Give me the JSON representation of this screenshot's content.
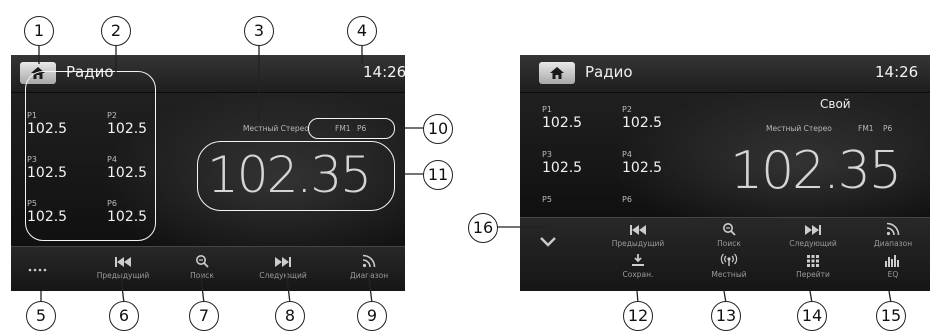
{
  "screen1": {
    "title": "Радио",
    "clock": "14:26",
    "presets": [
      {
        "label": "P1",
        "freq": "102.5"
      },
      {
        "label": "P2",
        "freq": "102.5"
      },
      {
        "label": "P3",
        "freq": "102.5"
      },
      {
        "label": "P4",
        "freq": "102.5"
      },
      {
        "label": "P5",
        "freq": "102.5"
      },
      {
        "label": "P6",
        "freq": "102.5"
      }
    ],
    "status_text": "Местный Стерео",
    "band": "FM1",
    "preset_indicator": "P6",
    "frequency": "102.35",
    "buttons": [
      {
        "label": "",
        "icon": "more-dots-icon"
      },
      {
        "label": "Предыдущий",
        "icon": "previous-icon"
      },
      {
        "label": "Поиск",
        "icon": "search-icon"
      },
      {
        "label": "Следующий",
        "icon": "next-icon"
      },
      {
        "label": "Диапазон",
        "icon": "band-icon"
      }
    ]
  },
  "screen2": {
    "title": "Радио",
    "clock": "14:26",
    "custom_label": "Свой",
    "presets": [
      {
        "label": "P1",
        "freq": "102.5"
      },
      {
        "label": "P2",
        "freq": "102.5"
      },
      {
        "label": "P3",
        "freq": "102.5"
      },
      {
        "label": "P4",
        "freq": "102.5"
      },
      {
        "label": "P5",
        "freq": ""
      },
      {
        "label": "P6",
        "freq": ""
      }
    ],
    "status_text": "Местный Стерео",
    "band": "FM1",
    "preset_indicator": "P6",
    "frequency": "102.35",
    "buttons_row1": [
      {
        "label": "Предыдущий",
        "icon": "previous-icon"
      },
      {
        "label": "Поиск",
        "icon": "search-icon"
      },
      {
        "label": "Следующий",
        "icon": "next-icon"
      },
      {
        "label": "Диапазон",
        "icon": "band-icon"
      }
    ],
    "buttons_row2": [
      {
        "label": "Сохран.",
        "icon": "save-icon"
      },
      {
        "label": "Местный",
        "icon": "local-icon"
      },
      {
        "label": "Перейти",
        "icon": "goto-keypad-icon"
      },
      {
        "label": "EQ",
        "icon": "eq-icon"
      }
    ]
  },
  "callouts": [
    "1",
    "2",
    "3",
    "4",
    "5",
    "6",
    "7",
    "8",
    "9",
    "10",
    "11",
    "12",
    "13",
    "14",
    "15",
    "16"
  ]
}
